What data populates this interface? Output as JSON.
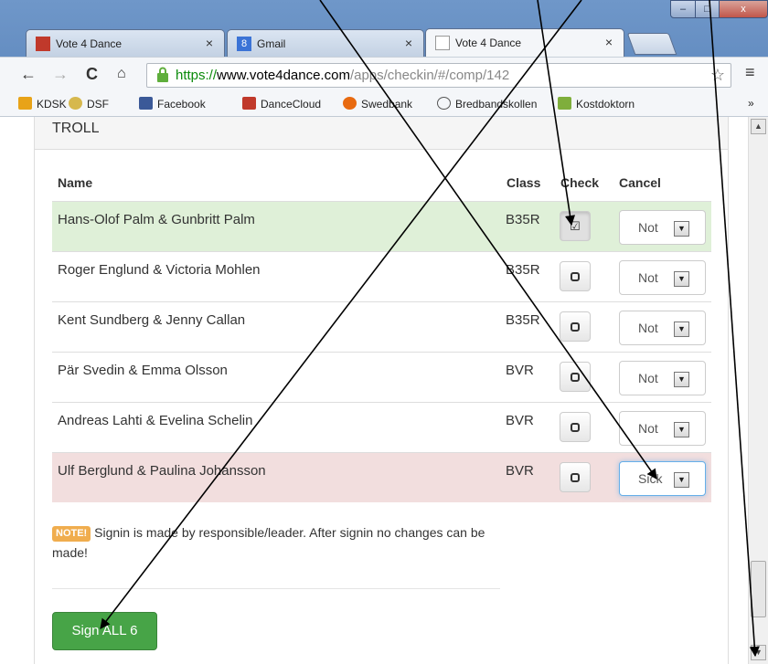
{
  "browser": {
    "tabs": [
      {
        "title": "Vote 4 Dance",
        "close": "×"
      },
      {
        "title": "Gmail",
        "close": "×"
      },
      {
        "title": "Vote 4 Dance",
        "close": "×"
      }
    ],
    "window_controls": {
      "min": "–",
      "max": "□",
      "close": "x"
    },
    "nav": {
      "back": "←",
      "forward": "→",
      "reload": "C",
      "home": "🏠"
    },
    "url": {
      "scheme": "https://",
      "host": "www.vote4dance.com",
      "path": "/apps/checkin/#/comp/142"
    },
    "star": "☆",
    "menu": "≡",
    "bookmarks": [
      "KDSK",
      "DSF",
      "Facebook",
      "DanceCloud",
      "Swedbank",
      "Bredbandskollen",
      "Kostdoktorn"
    ],
    "bookmarks_more": "»"
  },
  "panel": {
    "heading": "TROLL"
  },
  "table": {
    "headers": {
      "name": "Name",
      "class": "Class",
      "check": "Check",
      "cancel": "Cancel"
    },
    "rows": [
      {
        "name": "Hans-Olof Palm & Gunbritt Palm",
        "class": "B35R",
        "checked": true,
        "cancel": "Not",
        "state": "checked"
      },
      {
        "name": "Roger Englund & Victoria Mohlen",
        "class": "B35R",
        "checked": false,
        "cancel": "Not",
        "state": "normal"
      },
      {
        "name": "Kent Sundberg & Jenny Callan",
        "class": "B35R",
        "checked": false,
        "cancel": "Not",
        "state": "normal"
      },
      {
        "name": "Pär Svedin & Emma Olsson",
        "class": "BVR",
        "checked": false,
        "cancel": "Not",
        "state": "normal"
      },
      {
        "name": "Andreas Lahti & Evelina Schelin",
        "class": "BVR",
        "checked": false,
        "cancel": "Not",
        "state": "normal"
      },
      {
        "name": "Ulf Berglund & Paulina Johansson",
        "class": "BVR",
        "checked": false,
        "cancel": "Sick",
        "state": "cancelled"
      }
    ]
  },
  "note": {
    "badge": "NOTE!",
    "text": " Signin is made by responsible/leader. After signin no changes can be made!"
  },
  "sign_button": "Sign ALL 6",
  "colors": {
    "accent_green": "#47a447",
    "row_checked": "#dff0d8",
    "row_cancelled": "#f2dede",
    "badge": "#f0ad4e",
    "url_https": "#0a8a0a"
  }
}
